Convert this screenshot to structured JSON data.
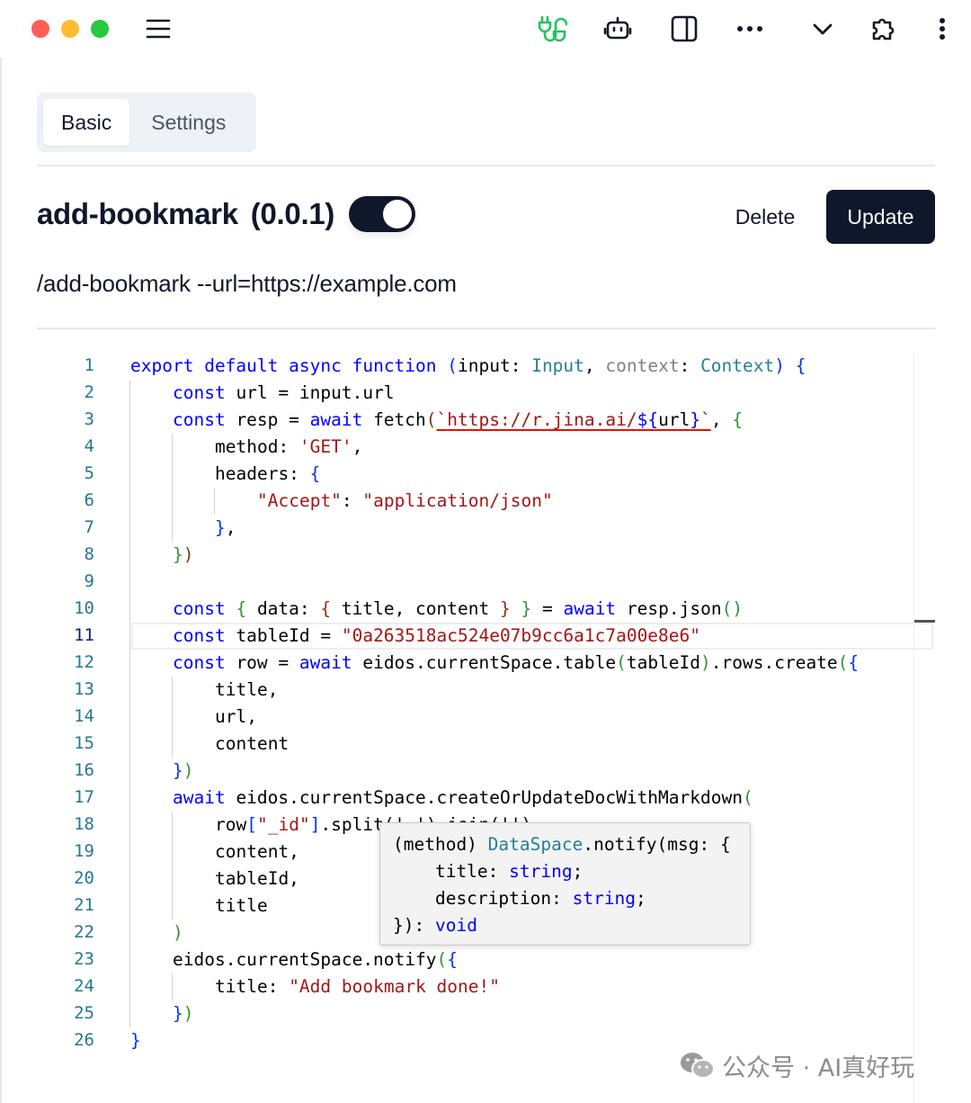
{
  "toolbar": {
    "icons": [
      "menu-icon",
      "plug-icon",
      "robot-icon",
      "sidebar-icon",
      "more-icon",
      "chevron-down-icon",
      "extension-icon",
      "kebab-icon"
    ],
    "accent_color": "#22c55e"
  },
  "tabs": [
    {
      "label": "Basic",
      "active": true
    },
    {
      "label": "Settings",
      "active": false
    }
  ],
  "header": {
    "name": "add-bookmark",
    "version": "(0.0.1)",
    "enabled": true,
    "delete_label": "Delete",
    "update_label": "Update"
  },
  "command": "/add-bookmark --url=https://example.com",
  "editor": {
    "line_numbers": [
      "1",
      "2",
      "3",
      "4",
      "5",
      "6",
      "7",
      "8",
      "9",
      "10",
      "11",
      "12",
      "13",
      "14",
      "15",
      "16",
      "17",
      "18",
      "19",
      "20",
      "21",
      "22",
      "23",
      "24",
      "25",
      "26"
    ],
    "active_line": 11,
    "code": [
      [
        "export",
        " ",
        "default",
        " ",
        "async",
        " ",
        "function",
        " ",
        "(",
        "input",
        ": ",
        "Input",
        ", ",
        "context",
        ": ",
        "Context",
        ")",
        " ",
        "{"
      ],
      [
        "const",
        " url = input.url"
      ],
      [
        "const",
        " resp = ",
        "await",
        " fetch",
        "(",
        "`",
        "https://r.jina.ai/",
        "${",
        "url",
        "}",
        "`",
        ", ",
        "{"
      ],
      [
        "method: ",
        "'GET'",
        ","
      ],
      [
        "headers: ",
        "{"
      ],
      [
        "\"Accept\"",
        ": ",
        "\"application/json\""
      ],
      [
        "}",
        ","
      ],
      [
        "}",
        ")"
      ],
      [
        ""
      ],
      [
        "const",
        " ",
        "{",
        " data: ",
        "{",
        " title, content ",
        "}",
        " ",
        "}",
        " = ",
        "await",
        " resp.json",
        "()"
      ],
      [
        "const",
        " tableId = ",
        "\"0a263518ac524e07b9cc6a1c7a00e8e6\""
      ],
      [
        "const",
        " row = ",
        "await",
        " eidos.currentSpace.table",
        "(",
        "tableId",
        ")",
        ".rows.create",
        "(",
        "{"
      ],
      [
        "title,"
      ],
      [
        "url,"
      ],
      [
        "content"
      ],
      [
        "}",
        ")"
      ],
      [
        "await",
        " eidos.currentSpace.createOrUpdateDocWithMarkdown",
        "("
      ],
      [
        "row",
        "[",
        "\"_id\"",
        "]",
        ".split",
        "('-')",
        ".join",
        "('')"
      ],
      [
        "content,"
      ],
      [
        "tableId,"
      ],
      [
        "title"
      ],
      [
        ")"
      ],
      [
        "eidos.currentSpace.notify",
        "(",
        "{"
      ],
      [
        "title: ",
        "\"Add bookmark done!\""
      ],
      [
        "}",
        ")"
      ],
      [
        "}"
      ]
    ],
    "hover": {
      "lines": [
        [
          "(method) ",
          "DataSpace",
          ".notify(msg: {"
        ],
        [
          "    title: ",
          "string",
          ";"
        ],
        [
          "    description: ",
          "string",
          ";"
        ],
        [
          "}): ",
          "void"
        ]
      ]
    }
  },
  "watermark": "公众号 · AI真好玩"
}
